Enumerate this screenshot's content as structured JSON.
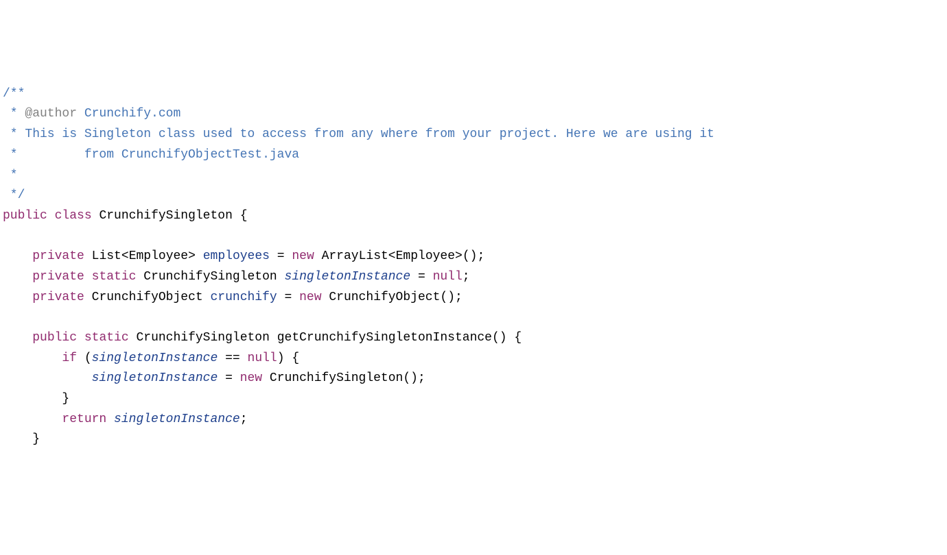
{
  "code": {
    "comment_open": "/**",
    "comment_star": " * ",
    "comment_star_empty": " *",
    "comment_close": " */",
    "javadoc_tag": "@author",
    "javadoc_value": " Crunchify.com",
    "comment_line1": "This is Singleton class used to access from any where from your project. Here we are using it",
    "comment_line2": "        from CrunchifyObjectTest.java",
    "kw_public": "public",
    "kw_class": "class",
    "kw_private": "private",
    "kw_static": "static",
    "kw_new": "new",
    "kw_if": "if",
    "kw_return": "return",
    "kw_null": "null",
    "class_name": "CrunchifySingleton",
    "type_list": "List",
    "type_employee": "Employee",
    "type_arraylist": "ArrayList",
    "type_crunchifyobject": "CrunchifyObject",
    "field_employees": "employees",
    "field_singletonInstance": "singletonInstance",
    "field_crunchify": "crunchify",
    "method_getInstance": "getCrunchifySingletonInstance",
    "sym_lt": "<",
    "sym_gt": ">",
    "sym_eq": " = ",
    "sym_eqeq": " == ",
    "sym_paren_open": "(",
    "sym_paren_close": ")",
    "sym_brace_open": "{",
    "sym_brace_close": "}",
    "sym_semi": ";",
    "sp": " "
  }
}
